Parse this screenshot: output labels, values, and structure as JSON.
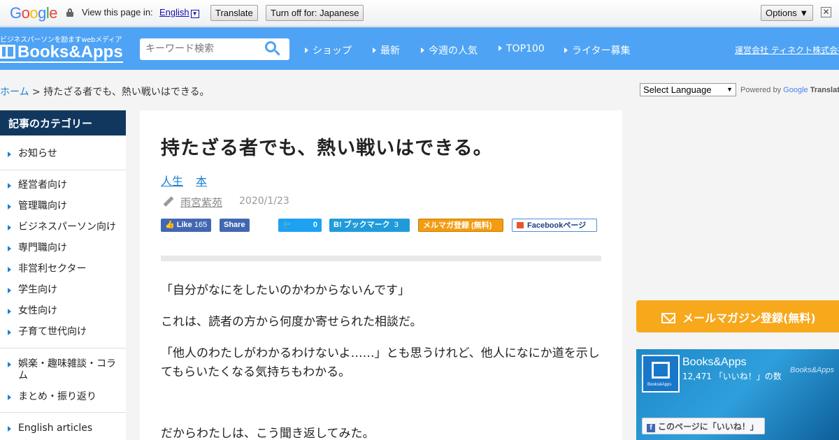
{
  "translate_bar": {
    "logo": "Google",
    "prompt": "View this page in:",
    "language": "English",
    "translate_button": "Translate",
    "turn_off_button": "Turn off for: Japanese",
    "options_button": "Options ▼",
    "close": "✕"
  },
  "header": {
    "tagline": "ビジネスパーソンを励ますwebメディア",
    "logo": "Books&Apps",
    "search_placeholder": "キーワード検索",
    "nav": [
      "ショップ",
      "最新",
      "今週の人気",
      "TOP100",
      "ライター募集"
    ],
    "company_link": "運営会社 ティネクト株式会社"
  },
  "breadcrumb": {
    "home": "ホーム",
    "separator": " > ",
    "current": "持たざる者でも、熱い戦いはできる。"
  },
  "language_select": {
    "value": "Select Language",
    "powered_by": "Powered by",
    "google": "Google",
    "translate": "Translate"
  },
  "sidebar": {
    "title": "記事のカテゴリー",
    "items": [
      "お知らせ",
      "経営者向け",
      "管理職向け",
      "ビジネスパーソン向け",
      "専門職向け",
      "非営利セクター",
      "学生向け",
      "女性向け",
      "子育て世代向け",
      "娯楽・趣味雑談・コラム",
      "まとめ・振り返り",
      "English articles"
    ]
  },
  "article": {
    "title": "持たざる者でも、熱い戦いはできる。",
    "tags": [
      "人生",
      "本"
    ],
    "author": "雨宮紫苑",
    "date": "2020/1/23",
    "share": {
      "fb_like": "Like",
      "fb_like_count": "165",
      "fb_share": "Share",
      "tweet_count": "0",
      "hatena": "B! ブックマーク",
      "hatena_count": "3",
      "mailmag": "メルマガ登録 (無料)",
      "fb_page": "Facebookページ"
    },
    "paragraphs": [
      "「自分がなにをしたいのかわからないんです」",
      "これは、読者の方から何度か寄せられた相談だ。",
      "「他人のわたしがわかるわけないよ……」とも思うけれど、他人になにか道を示してもらいたくなる気持ちもわかる。",
      "だからわたしは、こう聞き返してみた。"
    ]
  },
  "right": {
    "mail_button": "メールマガジン登録(無料)",
    "fb_page_name": "Books&Apps",
    "fb_count": "12,471 「いいね！」の数",
    "fb_watermark": "Books&Apps",
    "fb_avatar_caption": "Books&Apps",
    "fb_like_button": "このページに「いいね！」"
  },
  "colors": {
    "header_blue": "#4ea3f5",
    "sidebar_title_bg": "#11375f",
    "link_blue": "#1b7fd1",
    "mail_orange": "#f7a81b"
  }
}
